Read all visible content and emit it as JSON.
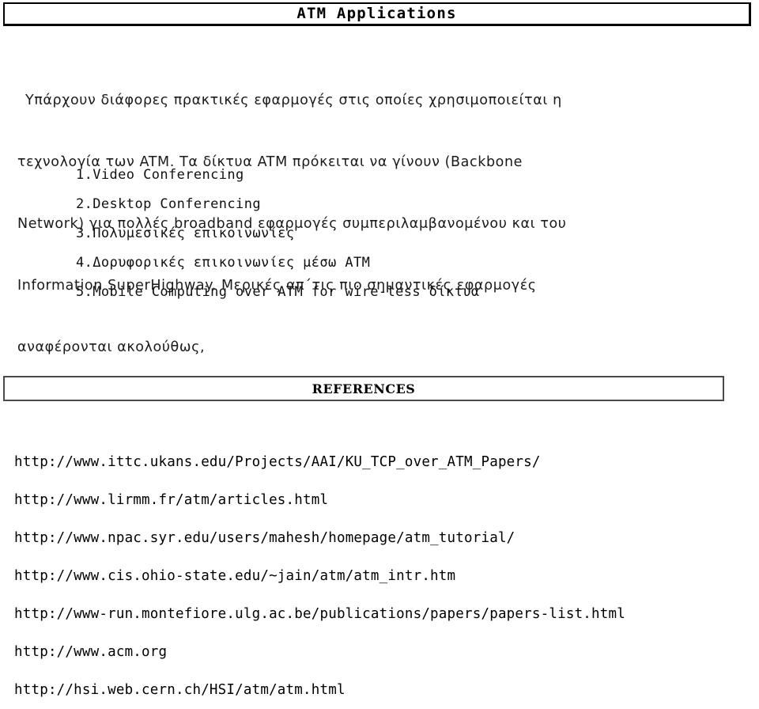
{
  "document": {
    "title": "ATM Applications",
    "intro_lines": [
      "Υπάρχουν διάφορες πρακτικές εφαρμογές στις οποίες χρησιμοποιείται η",
      "τεχνολογία των ATM. Τα δίκτυα ATM πρόκειται να γίνουν (Backbone",
      "Network) για πολλές broadband εφαρμογές συμπεριλαμβανομένου και του",
      "Information SuperHighway. Μερικές απ΄τις πιο σημαντικές εφαρμογές",
      "αναφέρονται ακολούθως,"
    ],
    "applications": [
      "1.Video Conferencing",
      "2.Desktop Conferencing",
      "3.Πολυμεσικές επικοινωνίες",
      "4.Δορυφορικές επικοινωνίες μέσω ATM",
      "5.Mobile Computing over ATM for wire-less δίκτυα"
    ],
    "references_heading": "REFERENCES",
    "references": [
      "http://www.ittc.ukans.edu/Projects/AAI/KU_TCP_over_ATM_Papers/",
      "http://www.lirmm.fr/atm/articles.html",
      "http://www.npac.syr.edu/users/mahesh/homepage/atm_tutorial/",
      "http://www.cis.ohio-state.edu/~jain/atm/atm_intr.htm",
      "http://www-run.montefiore.ulg.ac.be/publications/papers/papers-list.html",
      "http://www.acm.org",
      "http://hsi.web.cern.ch/HSI/atm/atm.html"
    ]
  },
  "colors": {
    "page_background": "#ffffff",
    "text": "#000000",
    "title_border": "#000000",
    "references_border": "#4a4a4a"
  }
}
